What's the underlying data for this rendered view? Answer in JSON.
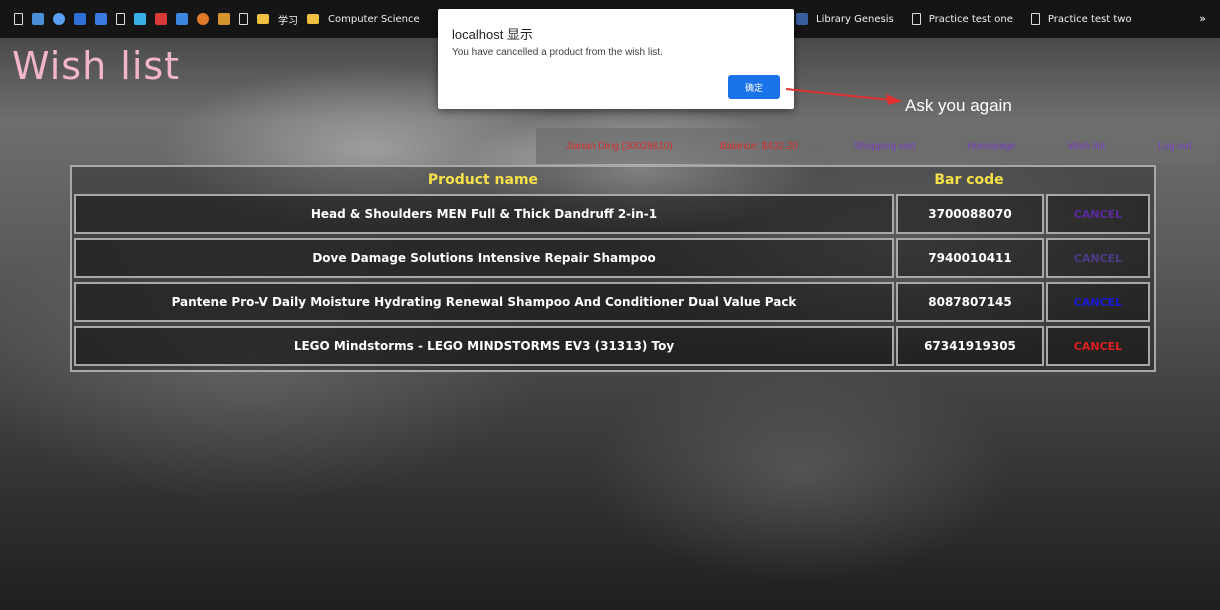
{
  "bookmarks": {
    "left_items": [
      {
        "icon": "page-icon"
      },
      {
        "icon": "bookmark-color-icon",
        "color": "#4a90d9"
      },
      {
        "icon": "bookmark-color-icon",
        "color": "#5aa0f0"
      },
      {
        "icon": "bookmark-color-icon",
        "color": "#2f6fd6"
      },
      {
        "icon": "bookmark-color-icon",
        "color": "#3a7be0"
      },
      {
        "icon": "page-icon"
      },
      {
        "icon": "bookmark-color-icon",
        "color": "#39b0e8"
      },
      {
        "icon": "bookmark-color-icon",
        "color": "#d93a3a"
      },
      {
        "icon": "bookmark-color-icon",
        "color": "#3a86e0"
      },
      {
        "icon": "bookmark-color-icon",
        "color": "#e07a2a"
      },
      {
        "icon": "bookmark-color-icon",
        "color": "#d6942a"
      },
      {
        "icon": "page-icon"
      },
      {
        "icon": "folder-icon",
        "color": "#f0c040"
      }
    ],
    "chinese_label": "学习",
    "computer_science": "Computer Science",
    "library_genesis": "Library Genesis",
    "practice_one": "Practice test one",
    "practice_two": "Practice test two",
    "chevron": "»"
  },
  "page_title": "Wish list",
  "dialog": {
    "title": "localhost 显示",
    "message": "You have cancelled a product from the wish list.",
    "ok_label": "确定",
    "button_color": "#1a73e8"
  },
  "annotation": {
    "text": "Ask you again",
    "arrow_color": "#e03030"
  },
  "nav": {
    "user": "Jianan Ding (30028610)",
    "balance": "Balance: $432.20",
    "shopping_cart": "Shopping cart",
    "homepage": "Homepage",
    "wish_list": "Wish list",
    "log_out": "Log out",
    "colors": {
      "user": "#d33030",
      "balance": "#d33030",
      "links": "#7a3fc0"
    }
  },
  "table": {
    "headers": {
      "name": "Product name",
      "code": "Bar code"
    },
    "header_color": "#f5e04a",
    "rows": [
      {
        "name": "Head & Shoulders MEN Full & Thick Dandruff 2-in-1",
        "code": "3700088070",
        "action": "CANCEL",
        "action_color": "#5b2a9e"
      },
      {
        "name": "Dove Damage Solutions Intensive Repair Shampoo",
        "code": "7940010411",
        "action": "CANCEL",
        "action_color": "#4e3a8a"
      },
      {
        "name": "Pantene Pro-V Daily Moisture Hydrating Renewal Shampoo And Conditioner Dual Value Pack",
        "code": "8087807145",
        "action": "CANCEL",
        "action_color": "#1a1ad6"
      },
      {
        "name": "LEGO Mindstorms - LEGO MINDSTORMS EV3 (31313) Toy",
        "code": "67341919305",
        "action": "CANCEL",
        "action_color": "#e02020"
      }
    ]
  }
}
